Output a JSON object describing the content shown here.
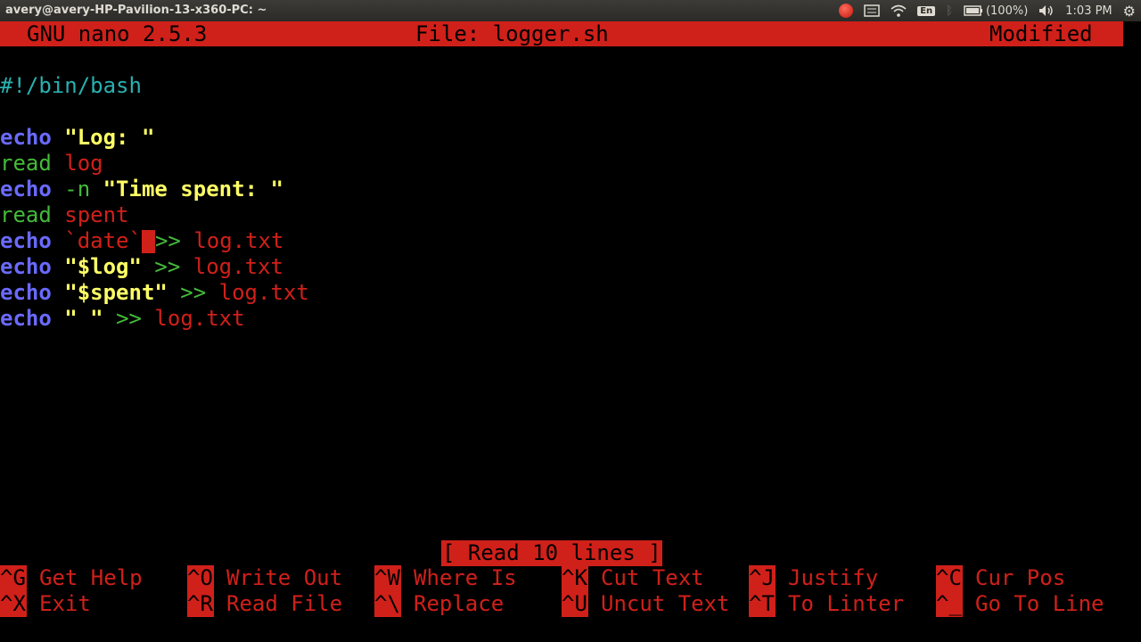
{
  "window": {
    "title": "avery@avery-HP-Pavilion-13-x360-PC: ~"
  },
  "tray": {
    "keyboard_layout": "En",
    "battery": "(100%)",
    "time": "1:03 PM",
    "icons": [
      "record-icon",
      "keyboard-menu-icon",
      "wifi-icon",
      "keyboard-layout-icon",
      "bluetooth-icon",
      "battery-icon",
      "volume-icon",
      "gear-icon"
    ]
  },
  "nano": {
    "version": "GNU nano 2.5.3",
    "file": "File: logger.sh",
    "state": "Modified",
    "status_message": "[ Read 10 lines ]"
  },
  "editor": {
    "line1": {
      "comment": "#!/bin/bash"
    },
    "line3": {
      "kw": "echo",
      "str": "\"Log: \""
    },
    "line4": {
      "cmd": "read",
      "var": "log"
    },
    "line5": {
      "kw": "echo",
      "flag": "-n",
      "str": "\"Time spent: \""
    },
    "line6": {
      "cmd": "read",
      "var": "spent"
    },
    "line7": {
      "kw": "echo",
      "tick": "`date`",
      "op": ">>",
      "file": "log.txt"
    },
    "line8": {
      "kw": "echo",
      "str": "\"$log\"",
      "op": ">>",
      "file": "log.txt"
    },
    "line9": {
      "kw": "echo",
      "str": "\"$spent\"",
      "op": ">>",
      "file": "log.txt"
    },
    "line10": {
      "kw": "echo",
      "str": "\" \"",
      "op": ">>",
      "file": "log.txt"
    }
  },
  "shortcuts": {
    "row1": [
      {
        "key": "^G",
        "label": "Get Help"
      },
      {
        "key": "^O",
        "label": "Write Out"
      },
      {
        "key": "^W",
        "label": "Where Is"
      },
      {
        "key": "^K",
        "label": "Cut Text"
      },
      {
        "key": "^J",
        "label": "Justify"
      },
      {
        "key": "^C",
        "label": "Cur Pos"
      }
    ],
    "row2": [
      {
        "key": "^X",
        "label": "Exit"
      },
      {
        "key": "^R",
        "label": "Read File"
      },
      {
        "key": "^\\",
        "label": "Replace"
      },
      {
        "key": "^U",
        "label": "Uncut Text"
      },
      {
        "key": "^T",
        "label": "To Linter"
      },
      {
        "key": "^_",
        "label": "Go To Line"
      }
    ]
  }
}
